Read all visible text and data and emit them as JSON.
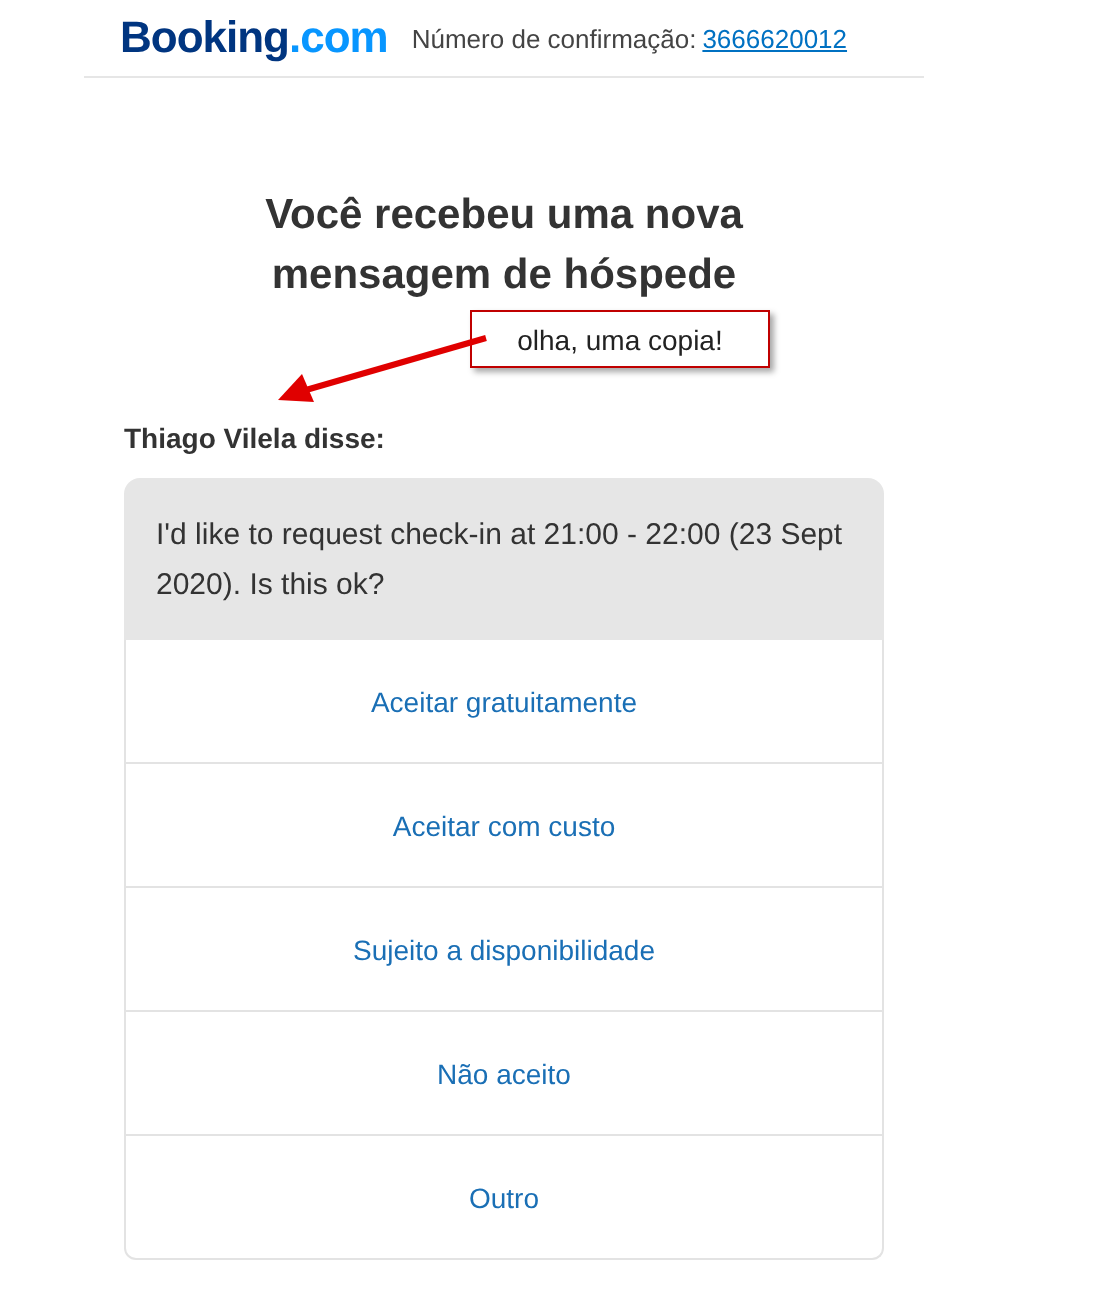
{
  "header": {
    "logo": {
      "name": "Booking",
      "suffix": ".com"
    },
    "confirmation_label": "Número de confirmação:",
    "confirmation_number": "3666620012"
  },
  "title": "Você recebeu uma nova mensagem de hóspede",
  "annotation": {
    "text": "olha, uma copia!"
  },
  "sender": "Thiago Vilela disse:",
  "message": "I'd like to request check-in at 21:00 - 22:00 (23 Sept 2020). Is this ok?",
  "options": [
    "Aceitar gratuitamente",
    "Aceitar com custo",
    "Sujeito a disponibilidade",
    "Não aceito",
    "Outro"
  ]
}
